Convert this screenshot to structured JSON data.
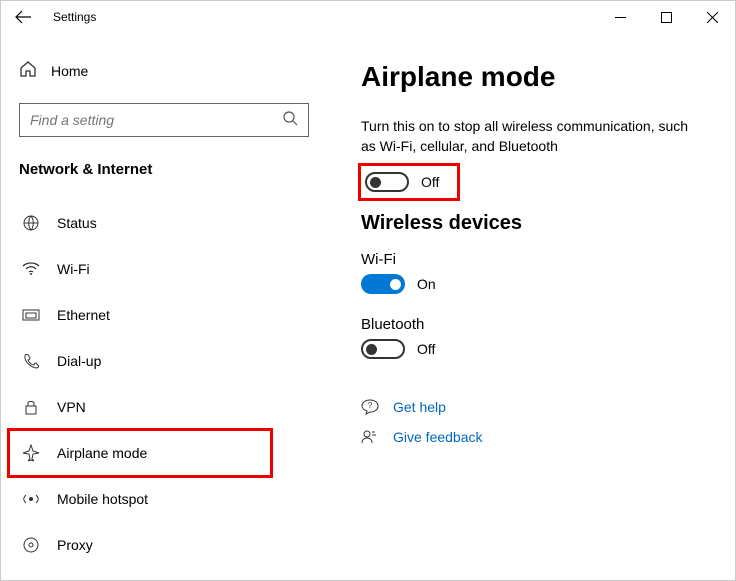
{
  "window": {
    "title": "Settings"
  },
  "sidebar": {
    "home_label": "Home",
    "search_placeholder": "Find a setting",
    "category_label": "Network & Internet",
    "items": [
      {
        "label": "Status"
      },
      {
        "label": "Wi-Fi"
      },
      {
        "label": "Ethernet"
      },
      {
        "label": "Dial-up"
      },
      {
        "label": "VPN"
      },
      {
        "label": "Airplane mode"
      },
      {
        "label": "Mobile hotspot"
      },
      {
        "label": "Proxy"
      }
    ]
  },
  "main": {
    "title": "Airplane mode",
    "description": "Turn this on to stop all wireless communication, such as Wi-Fi, cellular, and Bluetooth",
    "airplane_toggle": {
      "state": "Off"
    },
    "wireless_section_title": "Wireless devices",
    "wifi": {
      "label": "Wi-Fi",
      "state": "On"
    },
    "bluetooth": {
      "label": "Bluetooth",
      "state": "Off"
    },
    "help": {
      "label": "Get help"
    },
    "feedback": {
      "label": "Give feedback"
    }
  }
}
